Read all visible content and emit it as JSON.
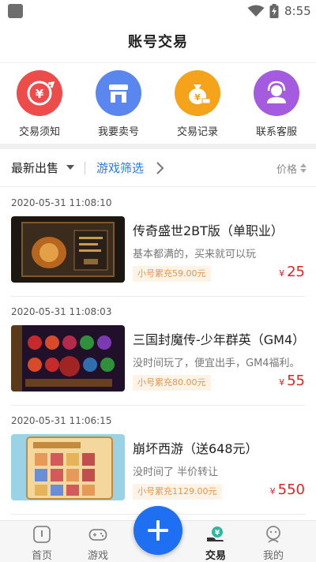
{
  "status_bar": {
    "time": "8:55"
  },
  "header": {
    "title": "账号交易"
  },
  "quick_entries": [
    {
      "label": "交易须知",
      "icon": "trade-rules-icon",
      "color": "#ee4b4b"
    },
    {
      "label": "我要卖号",
      "icon": "shop-icon",
      "color": "#5a86f0"
    },
    {
      "label": "交易记录",
      "icon": "money-bag-icon",
      "color": "#f5a31a"
    },
    {
      "label": "联系客服",
      "icon": "customer-service-icon",
      "color": "#a45be0"
    }
  ],
  "filter": {
    "latest_label": "最新出售",
    "game_filter_label": "游戏筛选",
    "price_label": "价格"
  },
  "listings": [
    {
      "time": "2020-05-31 11:08:10",
      "title": "传奇盛世2BT版（单职业）",
      "desc": "基本都满的，买来就可以玩",
      "badge": "小号累充59.00元",
      "currency": "¥",
      "price": "25"
    },
    {
      "time": "2020-05-31 11:08:03",
      "title": "三国封魔传-少年群英（GM4）",
      "desc": "没时间玩了，便宜出手，GM4福利。",
      "badge": "小号累充80.00元",
      "currency": "¥",
      "price": "55"
    },
    {
      "time": "2020-05-31 11:06:15",
      "title": "崩坏西游（送648元）",
      "desc": "没时间了 半价转让",
      "badge": "小号累充1129.00元",
      "currency": "¥",
      "price": "550"
    }
  ],
  "tabbar": {
    "items": [
      {
        "label": "首页",
        "icon": "home-icon"
      },
      {
        "label": "游戏",
        "icon": "gamepad-icon"
      },
      {
        "label": "交易",
        "icon": "trade-icon",
        "active": true
      },
      {
        "label": "我的",
        "icon": "profile-icon"
      }
    ],
    "fab_icon": "plus-icon",
    "accent": "#1f6ff2"
  }
}
